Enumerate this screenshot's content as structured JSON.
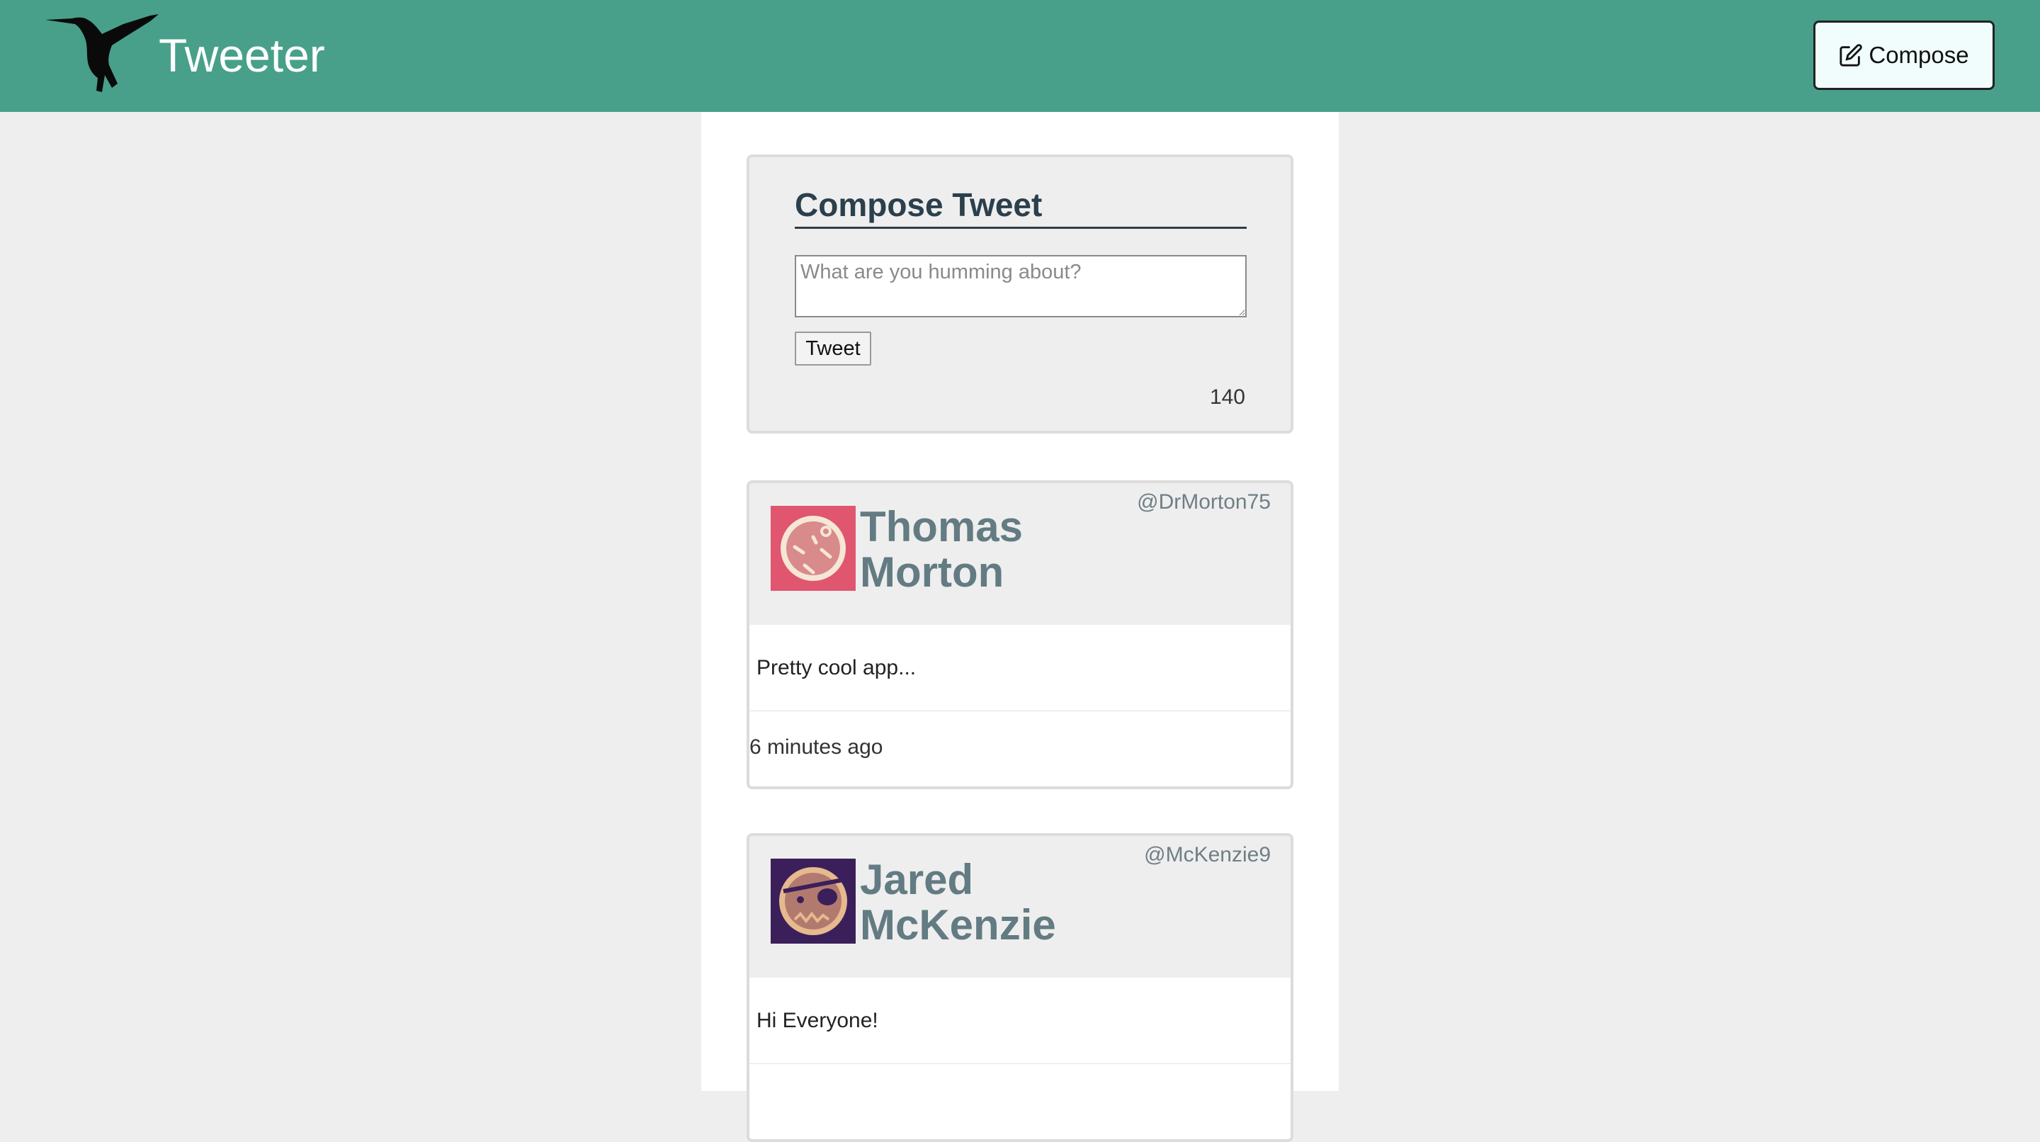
{
  "nav": {
    "brand": "Tweeter",
    "logo_icon": "hummingbird-icon",
    "compose_label": "Compose",
    "compose_icon": "edit-icon",
    "bg_color": "#48a08a"
  },
  "compose": {
    "title": "Compose Tweet",
    "placeholder": "What are you humming about?",
    "text": "",
    "submit_label": "Tweet",
    "counter": "140"
  },
  "tweets": [
    {
      "name": "Thomas Morton",
      "handle": "@DrMorton75",
      "avatar_icon": "dizzy-face-avatar-icon",
      "avatar_color": "#e0566f",
      "content": "Pretty cool app...",
      "time": "6 minutes ago"
    },
    {
      "name": "Jared McKenzie",
      "handle": "@McKenzie9",
      "avatar_icon": "pirate-face-avatar-icon",
      "avatar_color": "#3b1f5a",
      "content": "Hi Everyone!",
      "time": ""
    }
  ]
}
